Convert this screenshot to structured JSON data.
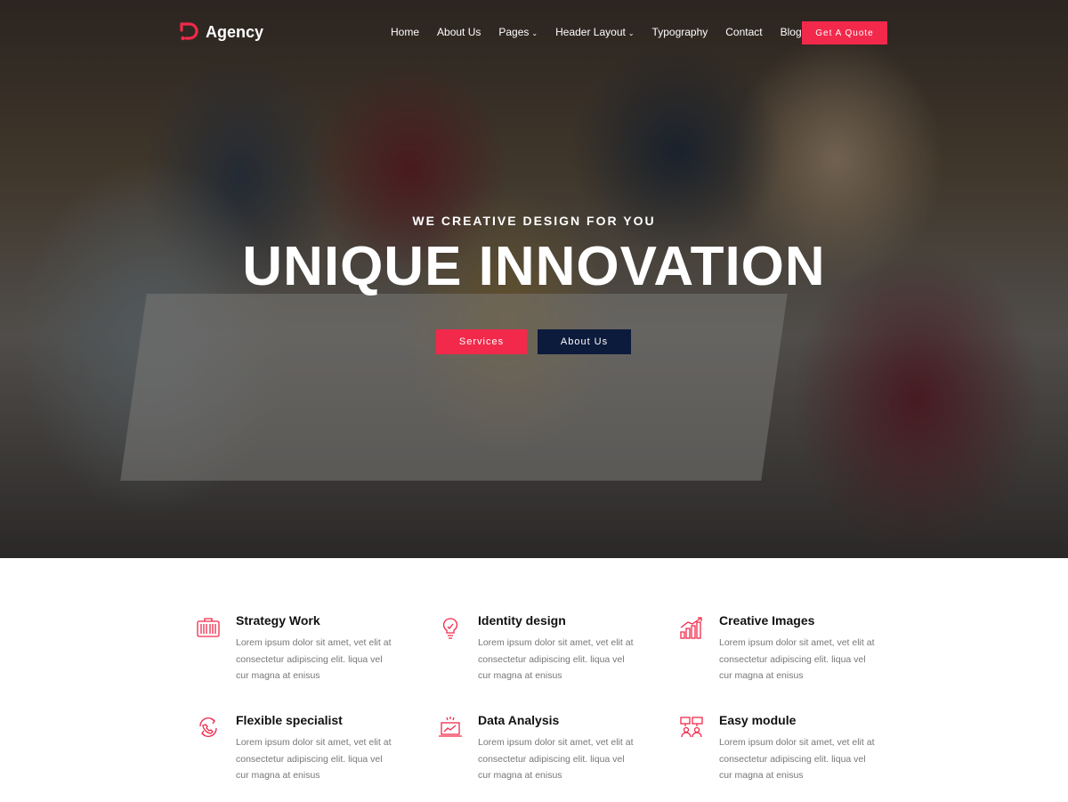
{
  "brand": {
    "name": "Agency",
    "accent": "#f2294b",
    "navy": "#0c1a3b"
  },
  "nav": {
    "items": [
      {
        "label": "Home",
        "dropdown": false
      },
      {
        "label": "About Us",
        "dropdown": false
      },
      {
        "label": "Pages",
        "dropdown": true
      },
      {
        "label": "Header Layout",
        "dropdown": true
      },
      {
        "label": "Typography",
        "dropdown": false
      },
      {
        "label": "Contact",
        "dropdown": false
      },
      {
        "label": "Blog",
        "dropdown": false
      }
    ],
    "cta": "Get A Quote"
  },
  "hero": {
    "subtitle": "WE CREATIVE DESIGN FOR YOU",
    "title": "UNIQUE INNOVATION",
    "btn_primary": "Services",
    "btn_secondary": "About Us"
  },
  "features": [
    {
      "icon": "briefcase-icon",
      "title": "Strategy Work",
      "text": "Lorem ipsum dolor sit amet, vet elit at consectetur adipiscing elit. liqua vel cur magna at enisus"
    },
    {
      "icon": "lightbulb-icon",
      "title": "Identity design",
      "text": "Lorem ipsum dolor sit amet, vet elit at consectetur adipiscing elit. liqua vel cur magna at enisus"
    },
    {
      "icon": "growth-chart-icon",
      "title": "Creative Images",
      "text": "Lorem ipsum dolor sit amet, vet elit at consectetur adipiscing elit. liqua vel cur magna at enisus"
    },
    {
      "icon": "refresh-phone-icon",
      "title": "Flexible specialist",
      "text": "Lorem ipsum dolor sit amet, vet elit at consectetur adipiscing elit. liqua vel cur magna at enisus"
    },
    {
      "icon": "laptop-analytics-icon",
      "title": "Data Analysis",
      "text": "Lorem ipsum dolor sit amet, vet elit at consectetur adipiscing elit. liqua vel cur magna at enisus"
    },
    {
      "icon": "team-board-icon",
      "title": "Easy module",
      "text": "Lorem ipsum dolor sit amet, vet elit at consectetur adipiscing elit. liqua vel cur magna at enisus"
    }
  ]
}
